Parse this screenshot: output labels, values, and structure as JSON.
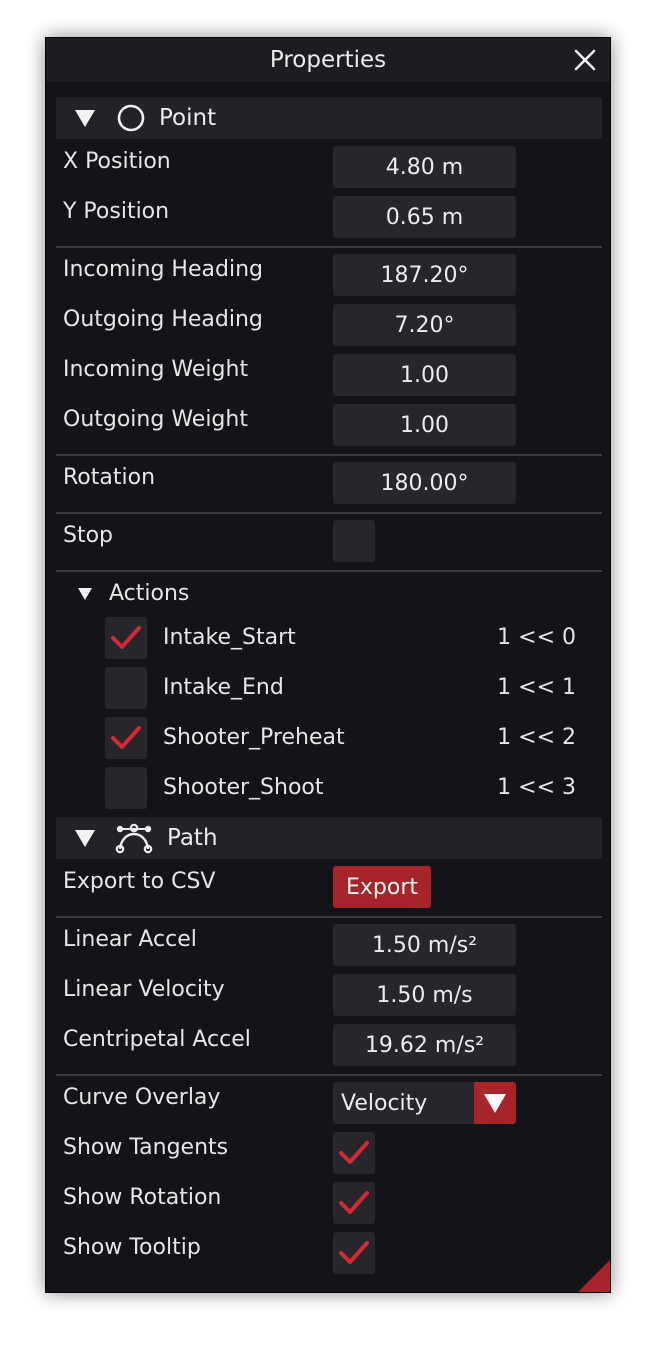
{
  "window": {
    "title": "Properties"
  },
  "point": {
    "header": "Point",
    "x_position": {
      "label": "X Position",
      "value": "4.80 m"
    },
    "y_position": {
      "label": "Y Position",
      "value": "0.65 m"
    },
    "incoming_heading": {
      "label": "Incoming Heading",
      "value": "187.20°"
    },
    "outgoing_heading": {
      "label": "Outgoing Heading",
      "value": "7.20°"
    },
    "incoming_weight": {
      "label": "Incoming Weight",
      "value": "1.00"
    },
    "outgoing_weight": {
      "label": "Outgoing Weight",
      "value": "1.00"
    },
    "rotation": {
      "label": "Rotation",
      "value": "180.00°"
    },
    "stop": {
      "label": "Stop",
      "checked": false
    }
  },
  "actions": {
    "header": "Actions",
    "items": [
      {
        "label": "Intake_Start",
        "value": "1 << 0",
        "checked": true
      },
      {
        "label": "Intake_End",
        "value": "1 << 1",
        "checked": false
      },
      {
        "label": "Shooter_Preheat",
        "value": "1 << 2",
        "checked": true
      },
      {
        "label": "Shooter_Shoot",
        "value": "1 << 3",
        "checked": false
      }
    ]
  },
  "path": {
    "header": "Path",
    "export": {
      "label": "Export to CSV",
      "button": "Export"
    },
    "linear_accel": {
      "label": "Linear Accel",
      "value": "1.50 m/s²"
    },
    "linear_velocity": {
      "label": "Linear Velocity",
      "value": "1.50 m/s"
    },
    "centripetal_accel": {
      "label": "Centripetal Accel",
      "value": "19.62 m/s²"
    },
    "curve_overlay": {
      "label": "Curve Overlay",
      "value": "Velocity"
    },
    "show_tangents": {
      "label": "Show Tangents",
      "checked": true
    },
    "show_rotation": {
      "label": "Show Rotation",
      "checked": true
    },
    "show_tooltip": {
      "label": "Show Tooltip",
      "checked": true
    }
  },
  "colors": {
    "accent": "#a8242b",
    "check": "#d42a36",
    "background": "#141418",
    "field": "#26262c"
  }
}
